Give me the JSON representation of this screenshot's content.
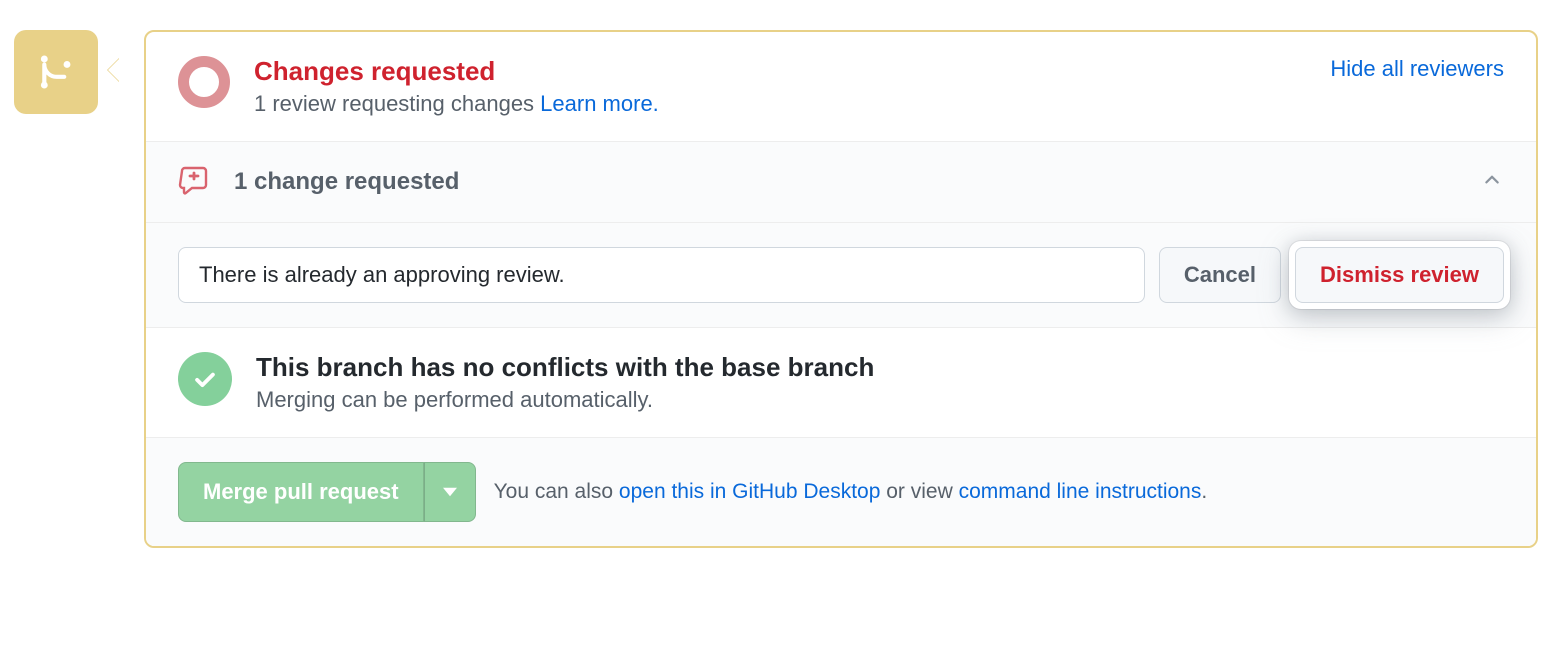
{
  "status": {
    "title": "Changes requested",
    "subtitle_prefix": "1 review requesting changes ",
    "learn_more": "Learn more.",
    "hide_reviewers": "Hide all reviewers"
  },
  "changes": {
    "summary": "1 change requested"
  },
  "dismiss": {
    "input_value": "There is already an approving review.",
    "cancel": "Cancel",
    "dismiss": "Dismiss review"
  },
  "conflicts": {
    "title": "This branch has no conflicts with the base branch",
    "subtitle": "Merging can be performed automatically."
  },
  "merge": {
    "button": "Merge pull request",
    "help_prefix": "You can also ",
    "link_desktop": "open this in GitHub Desktop",
    "help_middle": " or view ",
    "link_cli": "command line instructions",
    "help_suffix": "."
  }
}
